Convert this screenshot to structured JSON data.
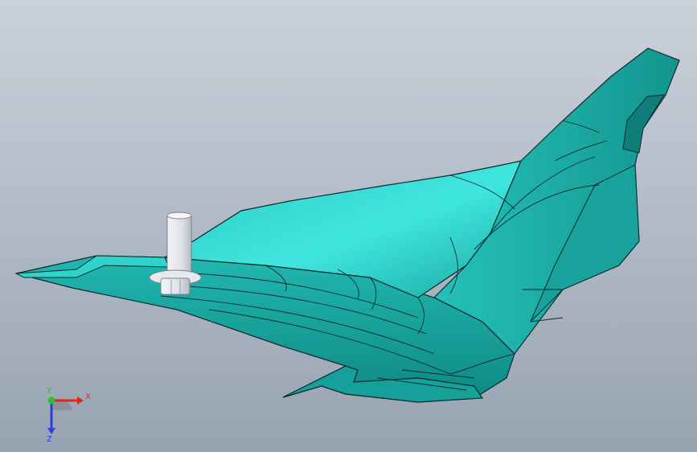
{
  "viewport": {
    "background_top": "#cbd1da",
    "background_bottom": "#98a3b2"
  },
  "model": {
    "body_color": "#1fb3ad",
    "highlight_color": "#3fe6df",
    "shadow_color": "#0f7e7a",
    "edge_color": "#0b2a2a",
    "pin_color": "#e8e9ee"
  },
  "triad": {
    "x_label": "X",
    "y_label": "Y",
    "z_label": "Z",
    "x_color": "#e0261d",
    "y_color": "#2fbf2f",
    "z_color": "#2c3fd6"
  }
}
